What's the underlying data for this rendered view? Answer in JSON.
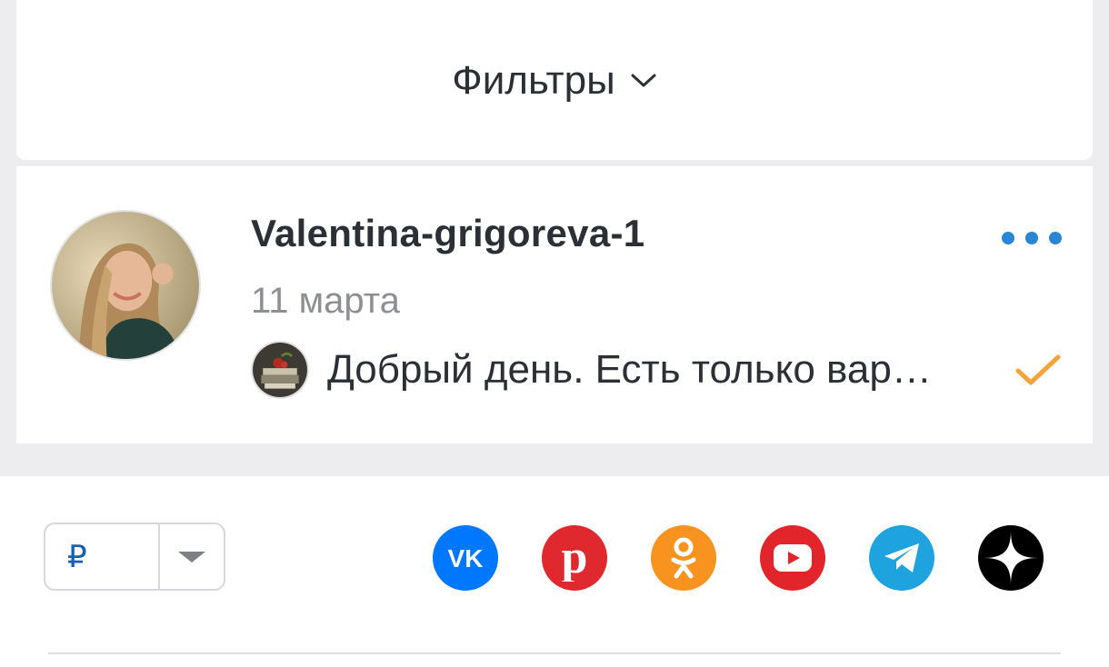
{
  "filters": {
    "label": "Фильтры"
  },
  "message": {
    "username": "Valentina-grigoreva-1",
    "date": "11 марта",
    "preview": "Добрый день. Есть только вар…",
    "status": "read"
  },
  "currency": {
    "symbol": "₽"
  },
  "social_links": [
    {
      "name": "vk",
      "color": "#0077ff"
    },
    {
      "name": "pinterest",
      "color": "#e0282f"
    },
    {
      "name": "odnoklassniki",
      "color": "#f7931e"
    },
    {
      "name": "youtube",
      "color": "#e1252a"
    },
    {
      "name": "telegram",
      "color": "#1fa3df"
    },
    {
      "name": "dzen",
      "color": "#000000"
    }
  ],
  "colors": {
    "accent": "#2a85d4",
    "check": "#f5a33b",
    "page_background": "#ededf0"
  }
}
